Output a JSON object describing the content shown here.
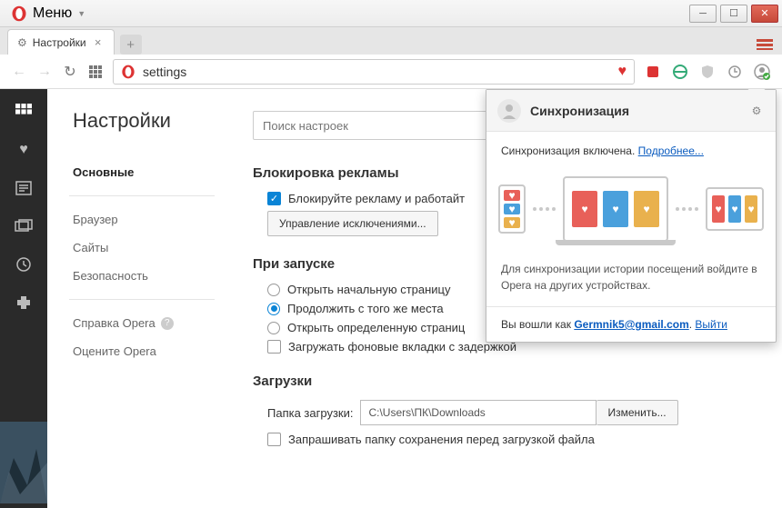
{
  "menu_label": "Меню",
  "tab": {
    "title": "Настройки"
  },
  "url": "settings",
  "page_title": "Настройки",
  "search_placeholder": "Поиск настроек",
  "sidebar": {
    "items": [
      {
        "label": "Основные",
        "active": true
      },
      {
        "label": "Браузер"
      },
      {
        "label": "Сайты"
      },
      {
        "label": "Безопасность"
      }
    ],
    "help": "Справка Opera",
    "rate": "Оцените Opera"
  },
  "sections": {
    "ads": {
      "title": "Блокировка рекламы",
      "block_label": "Блокируйте рекламу и работайт",
      "exceptions_btn": "Управление исключениями..."
    },
    "startup": {
      "title": "При запуске",
      "opt1": "Открыть начальную страницу",
      "opt2": "Продолжить с того же места",
      "opt3": "Открыть определенную страниц",
      "delay": "Загружать фоновые вкладки с задержкой"
    },
    "downloads": {
      "title": "Загрузки",
      "folder_label": "Папка загрузки:",
      "folder_path": "C:\\Users\\ПК\\Downloads",
      "change_btn": "Изменить...",
      "ask_label": "Запрашивать папку сохранения перед загрузкой файла"
    }
  },
  "sync": {
    "title": "Синхронизация",
    "status": "Синхронизация включена.",
    "more": "Подробнее...",
    "hint": "Для синхронизации истории посещений войдите в Opera на других устройствах.",
    "logged_as": "Вы вошли как",
    "email": "Germnik5@gmail.com",
    "logout": "Выйти"
  }
}
